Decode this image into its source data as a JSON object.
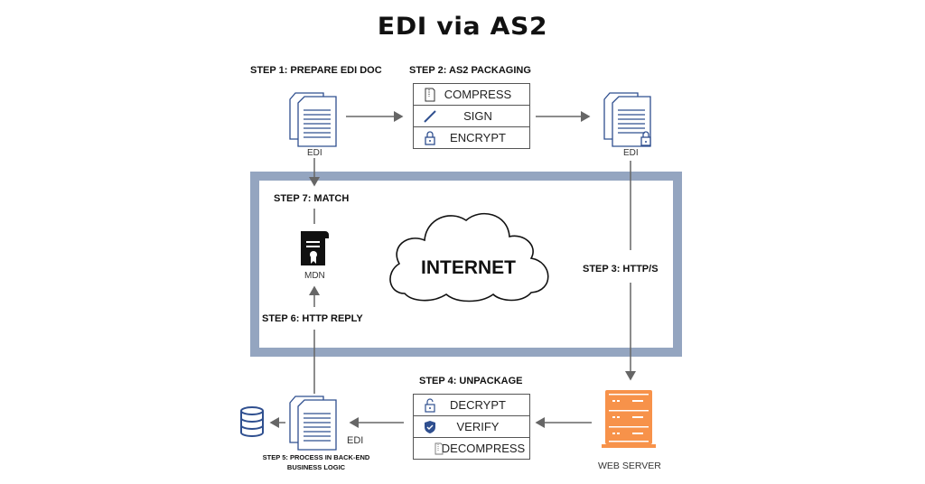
{
  "title": "EDI via AS2",
  "steps": {
    "step1": "STEP 1: PREPARE EDI DOC",
    "step2": "STEP 2: AS2 PACKAGING",
    "step3": "STEP 3: HTTP/S",
    "step4": "STEP 4: UNPACKAGE",
    "step5_line1": "STEP 5: PROCESS IN BACK-END",
    "step5_line2": "BUSINESS LOGIC",
    "step6": "STEP 6: HTTP  REPLY",
    "step7": "STEP 7: MATCH"
  },
  "packaging": {
    "rows": [
      {
        "label": "COMPRESS",
        "icon": "zip-file-icon"
      },
      {
        "label": "SIGN",
        "icon": "pen-icon"
      },
      {
        "label": "ENCRYPT",
        "icon": "lock-icon"
      }
    ]
  },
  "unpackaging": {
    "rows": [
      {
        "label": "DECRYPT",
        "icon": "unlock-icon"
      },
      {
        "label": "VERIFY",
        "icon": "shield-check-icon"
      },
      {
        "label": "DECOMPRESS",
        "icon": "zip-file-icon"
      }
    ]
  },
  "captions": {
    "edi_source": "EDI",
    "edi_encrypted": "EDI",
    "edi_received": "EDI",
    "mdn": "MDN",
    "internet": "INTERNET",
    "web_server": "WEB SERVER"
  },
  "colors": {
    "doc_blue": "#2f4f8f",
    "frame": "#94a5c0",
    "server_orange": "#f7924a",
    "arrow_gray": "#666666"
  }
}
